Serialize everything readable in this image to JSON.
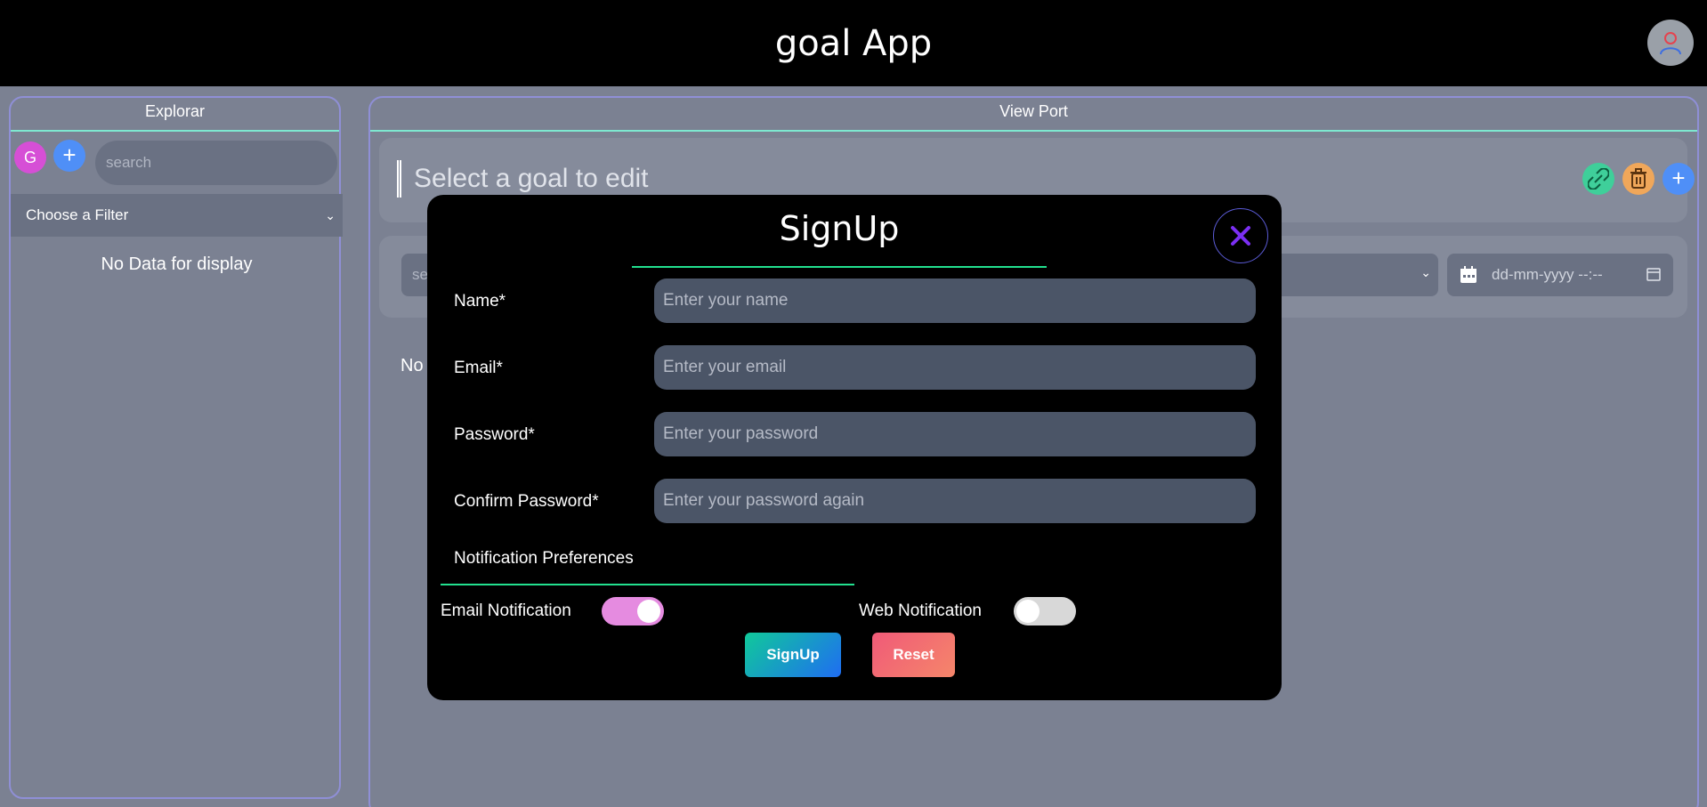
{
  "header": {
    "title": "goal App"
  },
  "explorer": {
    "title": "Explorar",
    "avatar_letter": "G",
    "add_label": "+",
    "search_placeholder": "search",
    "filter_label": "Choose a Filter",
    "empty_text": "No Data for display"
  },
  "viewport": {
    "title": "View Port",
    "goal_placeholder": "Select a goal to edit",
    "search_placeholder": "se",
    "date_placeholder": "dd-mm-yyyy --:--",
    "empty_text": "No",
    "add_label": "+"
  },
  "modal": {
    "title": "SignUp",
    "fields": [
      {
        "label": "Name*",
        "placeholder": "Enter your name"
      },
      {
        "label": "Email*",
        "placeholder": "Enter your email"
      },
      {
        "label": "Password*",
        "placeholder": "Enter your password"
      },
      {
        "label": "Confirm Password*",
        "placeholder": "Enter your password again"
      }
    ],
    "notifications_title": "Notification Preferences",
    "email_notification": {
      "label": "Email Notification",
      "enabled": true
    },
    "web_notification": {
      "label": "Web Notification",
      "enabled": false
    },
    "signup_label": "SignUp",
    "reset_label": "Reset"
  },
  "colors": {
    "accent_green": "#22e08f",
    "signup_gradient": [
      "#10c99a",
      "#1f6df2"
    ],
    "reset_gradient": [
      "#f05a78",
      "#f5866a"
    ],
    "toggle_on": "#e58be0"
  },
  "icons": {
    "user": "user-icon",
    "link": "link-icon",
    "trash": "trash-icon",
    "calendar": "calendar-icon",
    "close": "close-icon"
  }
}
